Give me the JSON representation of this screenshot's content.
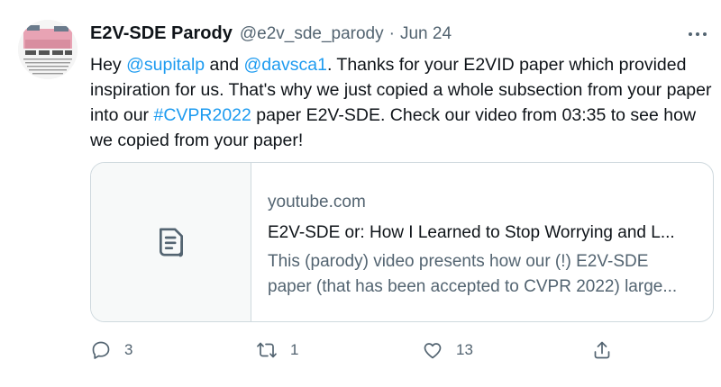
{
  "author": {
    "display_name": "E2V-SDE Parody",
    "handle": "@e2v_sde_parody",
    "separator": "·",
    "date": "Jun 24"
  },
  "tweet": {
    "segments": [
      {
        "text": "Hey ",
        "link": false
      },
      {
        "text": "@supitalp",
        "link": true
      },
      {
        "text": " and ",
        "link": false
      },
      {
        "text": "@davsca1",
        "link": true
      },
      {
        "text": ". Thanks for your E2VID paper which provided inspiration for us. That's why we just copied a whole subsection from your paper into our ",
        "link": false
      },
      {
        "text": "#CVPR2022",
        "link": true
      },
      {
        "text": " paper E2V-SDE. Check our video from 03:35 to see how we copied from your paper!",
        "link": false
      }
    ]
  },
  "card": {
    "icon": "document-icon",
    "domain": "youtube.com",
    "title": "E2V-SDE or: How I Learned to Stop Worrying and L...",
    "description_line1": "This (parody) video presents how our (!) E2V-SDE",
    "description_line2": "paper (that has been accepted to CVPR 2022) large..."
  },
  "actions": {
    "reply_count": "3",
    "retweet_count": "1",
    "like_count": "13"
  },
  "colors": {
    "link": "#1d9bf0",
    "secondary_text": "#536471",
    "border": "#cfd9de"
  }
}
